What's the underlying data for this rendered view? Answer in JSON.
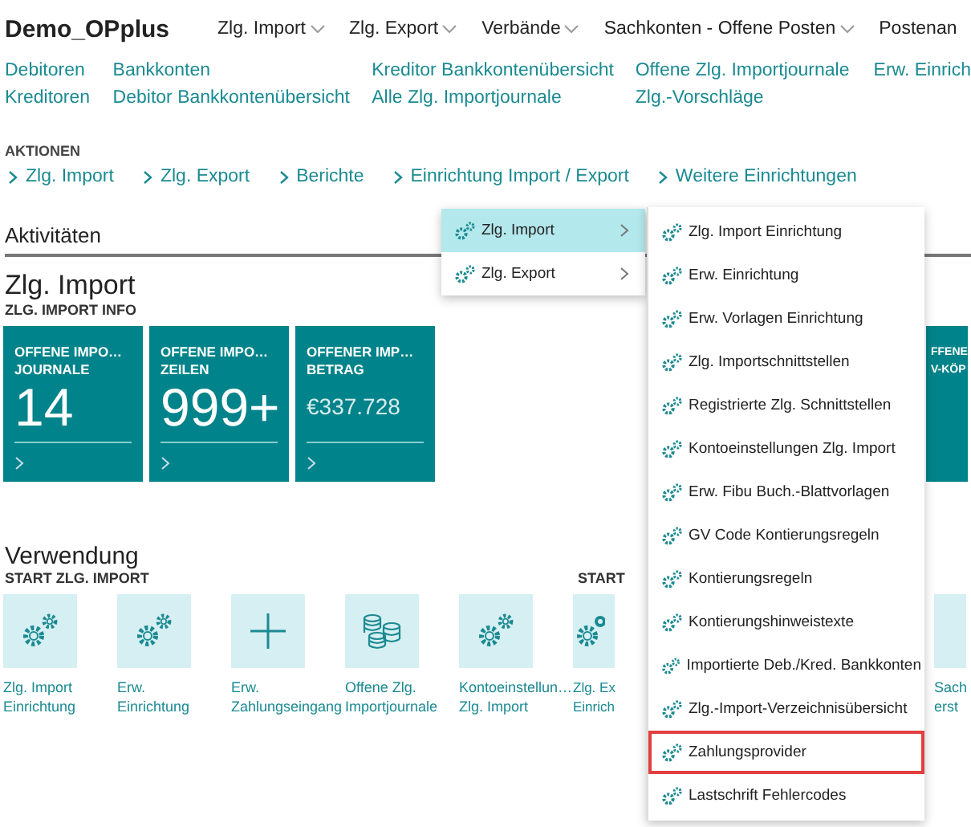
{
  "app_title": "Demo_OPplus",
  "nav": [
    {
      "label": "Zlg. Import",
      "has_menu": true
    },
    {
      "label": "Zlg. Export",
      "has_menu": true
    },
    {
      "label": "Verbände",
      "has_menu": true
    },
    {
      "label": "Sachkonten - Offene Posten",
      "has_menu": true
    },
    {
      "label": "Postenan",
      "has_menu": false
    }
  ],
  "link_columns": [
    [
      "Debitoren",
      "Kreditoren"
    ],
    [
      "Bankkonten",
      "Debitor Bankkontenübersicht"
    ],
    [
      "Kreditor Bankkontenübersicht",
      "Alle Zlg. Importjournale"
    ],
    [
      "Offene Zlg. Importjournale",
      "Zlg.-Vorschläge"
    ],
    [
      "Erw. Einrich"
    ]
  ],
  "actions": {
    "heading": "AKTIONEN",
    "items": [
      "Zlg. Import",
      "Zlg. Export",
      "Berichte",
      "Einrichtung Import / Export",
      "Weitere Einrichtungen"
    ]
  },
  "menu": [
    {
      "label": "Zlg. Import",
      "selected": true
    },
    {
      "label": "Zlg. Export",
      "selected": false
    }
  ],
  "submenu": [
    {
      "label": "Zlg. Import Einrichtung",
      "highlighted": false
    },
    {
      "label": "Erw. Einrichtung",
      "highlighted": false
    },
    {
      "label": "Erw. Vorlagen Einrichtung",
      "highlighted": false
    },
    {
      "label": "Zlg. Importschnittstellen",
      "highlighted": false
    },
    {
      "label": "Registrierte Zlg. Schnittstellen",
      "highlighted": false
    },
    {
      "label": "Kontoeinstellungen Zlg. Import",
      "highlighted": false
    },
    {
      "label": "Erw. Fibu Buch.-Blattvorlagen",
      "highlighted": false
    },
    {
      "label": "GV Code Kontierungsregeln",
      "highlighted": false
    },
    {
      "label": "Kontierungsregeln",
      "highlighted": false
    },
    {
      "label": "Kontierungshinweistexte",
      "highlighted": false
    },
    {
      "label": "Importierte Deb./Kred. Bankkonten",
      "highlighted": false
    },
    {
      "label": "Zlg.-Import-Verzeichnisübersicht",
      "highlighted": false
    },
    {
      "label": "Zahlungsprovider",
      "highlighted": true
    },
    {
      "label": "Lastschrift Fehlercodes",
      "highlighted": false
    }
  ],
  "activities": {
    "heading": "Aktivitäten",
    "group_title": "Zlg. Import",
    "group_subtitle": "ZLG. IMPORT INFO",
    "tiles": [
      {
        "label_1": "OFFENE IMPO…",
        "label_2": "JOURNALE",
        "value": "14",
        "kind": "count"
      },
      {
        "label_1": "OFFENE IMPO…",
        "label_2": "ZEILEN",
        "value": "999+",
        "kind": "count"
      },
      {
        "label_1": "OFFENER IMP…",
        "label_2": "BETRAG",
        "value": "€337.728",
        "kind": "amount"
      }
    ],
    "partial_tile": {
      "label_1": "FFENE",
      "label_2": "V-KÖP"
    }
  },
  "usage": {
    "heading": "Verwendung",
    "group_title": "START ZLG. IMPORT",
    "items": [
      {
        "kind": "gears",
        "lines": [
          "Zlg. Import",
          "Einrichtung"
        ]
      },
      {
        "kind": "gears",
        "lines": [
          "Erw.",
          "Einrichtung"
        ]
      },
      {
        "kind": "plus",
        "lines": [
          "Erw.",
          "Zahlungseingang"
        ]
      },
      {
        "kind": "coins",
        "lines": [
          "Offene Zlg.",
          "Importjournale"
        ]
      },
      {
        "kind": "gears",
        "lines": [
          "Kontoeinstellun…",
          "Zlg. Import"
        ]
      }
    ],
    "second_group_title": "START",
    "second_items": [
      {
        "kind": "gears",
        "lines": [
          "Zlg. Ex",
          "Einrich"
        ]
      },
      {
        "kind": "plain",
        "lines": [
          "Sach",
          "erst"
        ]
      }
    ]
  }
}
